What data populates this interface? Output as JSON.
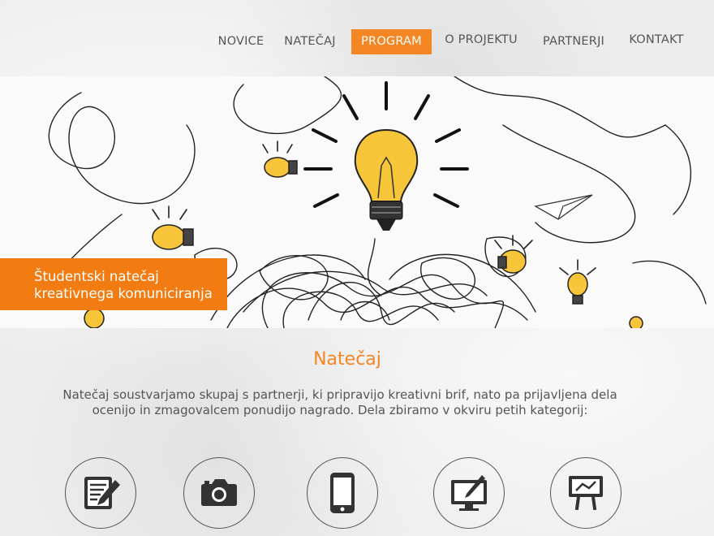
{
  "nav": {
    "items": [
      {
        "label": "NOVICE"
      },
      {
        "label": "NATEČAJ"
      },
      {
        "label": "PROGRAM"
      },
      {
        "label": "O PROJEKTU"
      },
      {
        "label": "PARTNERJI"
      },
      {
        "label": "KONTAKT"
      }
    ],
    "active_label": "PROGRAM",
    "accent_color": "#f58624"
  },
  "hero": {
    "tagline_line1": "Študentski natečaj",
    "tagline_line2": "kreativnega komuniciranja",
    "tagline_color": "#f27c12"
  },
  "section": {
    "title": "Natečaj",
    "intro": "Natečaj soustvarjamo skupaj s partnerji, ki pripravijo kreativni brif, nato pa prijavljena dela ocenijo in zmagovalcem ponudijo nagrado. Dela zbiramo v okviru petih kategorij:"
  },
  "categories": [
    {
      "icon": "pencil-paper-icon"
    },
    {
      "icon": "camera-icon"
    },
    {
      "icon": "smartphone-icon"
    },
    {
      "icon": "monitor-pen-icon"
    },
    {
      "icon": "presentation-board-icon"
    }
  ]
}
